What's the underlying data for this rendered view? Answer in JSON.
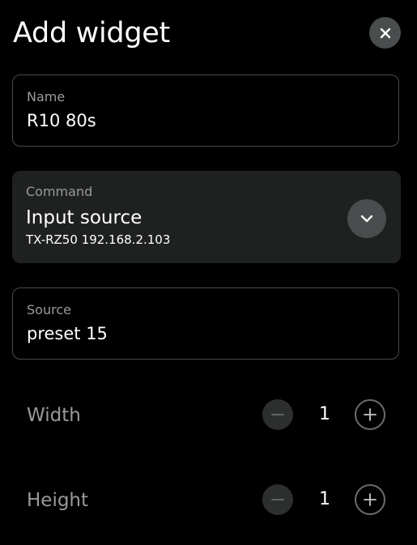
{
  "header": {
    "title": "Add widget",
    "close_icon": "close-icon"
  },
  "name_field": {
    "label": "Name",
    "value": "R10 80s"
  },
  "command_field": {
    "label": "Command",
    "value": "Input source",
    "subvalue": "TX-RZ50 192.168.2.103",
    "dropdown_icon": "chevron-down-icon"
  },
  "source_field": {
    "label": "Source",
    "value": "preset 15"
  },
  "width": {
    "label": "Width",
    "value": "1",
    "decrement_icon": "minus-icon",
    "increment_icon": "plus-icon"
  },
  "height": {
    "label": "Height",
    "value": "1",
    "decrement_icon": "minus-icon",
    "increment_icon": "plus-icon"
  },
  "colors": {
    "background": "#000000",
    "field_border": "#4a4a4a",
    "command_background": "#1f2121",
    "button_background": "#4a4d4d",
    "label_text": "#9a9a9a",
    "value_text": "#ffffff"
  }
}
